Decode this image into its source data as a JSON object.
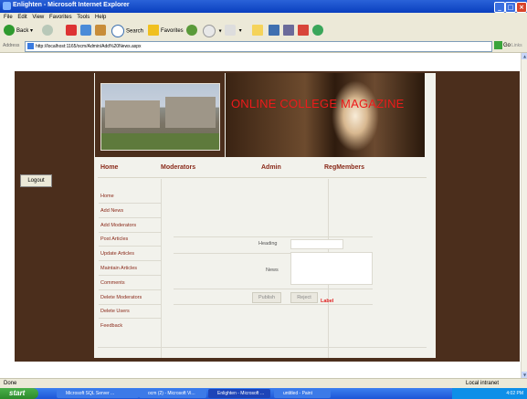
{
  "window": {
    "title": "Enlighten - Microsoft Internet Explorer"
  },
  "menubar": [
    "File",
    "Edit",
    "View",
    "Favorites",
    "Tools",
    "Help"
  ],
  "toolbar": {
    "back": "Back",
    "search": "Search",
    "favorites": "Favorites"
  },
  "address": {
    "label": "Address",
    "url": "http://localhost:1165/ocm/Admin/Add%20News.aspx",
    "go": "Go",
    "links": "Links"
  },
  "banner": {
    "title": "ONLINE COLLEGE MAGAZINE"
  },
  "nav": {
    "home": "Home",
    "moderators": "Moderators",
    "admin": "Admin",
    "regmembers": "RegMembers"
  },
  "logout": "Logout",
  "sidebar": {
    "items": [
      {
        "label": "Home"
      },
      {
        "label": "Add News"
      },
      {
        "label": "Add Moderators"
      },
      {
        "label": "Post Articles"
      },
      {
        "label": "Update Articles"
      },
      {
        "label": "Maintain Articles"
      },
      {
        "label": "Comments"
      },
      {
        "label": "Delete Moderators"
      },
      {
        "label": "Delete Users"
      },
      {
        "label": "Feedback"
      }
    ]
  },
  "form": {
    "heading_label": "Heading",
    "heading_value": "",
    "news_label": "News",
    "news_value": "",
    "publish": "Publish",
    "reject": "Reject",
    "status": "Label"
  },
  "statusbar": {
    "left": "Done",
    "zone": "Local intranet"
  },
  "taskbar": {
    "start": "start",
    "tasks": [
      {
        "label": "Microsoft SQL Server ..."
      },
      {
        "label": "ocm (2) - Microsoft Vi..."
      },
      {
        "label": "Enlighten - Microsoft ..."
      },
      {
        "label": "untitled - Paint"
      }
    ],
    "clock": "4:02 PM"
  },
  "colors": {
    "frame": "#4b2e1c",
    "navtext": "#8a2a1a",
    "bannertext": "#ee1a1a",
    "label": "#e02020"
  }
}
